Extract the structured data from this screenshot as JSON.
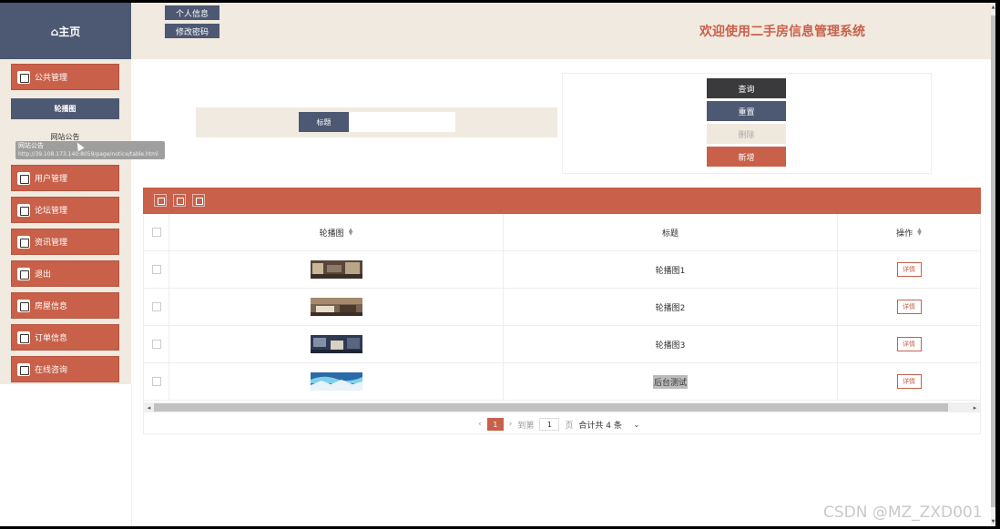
{
  "sidebar": {
    "home_label": "⌂主页",
    "menus": [
      {
        "label": "公共管理",
        "icon": "printer-icon"
      },
      {
        "label": "用户管理",
        "icon": "bar-chart-icon"
      },
      {
        "label": "论坛管理",
        "icon": "edit-icon"
      },
      {
        "label": "资讯管理",
        "icon": "bar-chart-icon"
      },
      {
        "label": "退出",
        "icon": "edit-icon"
      },
      {
        "label": "房屋信息",
        "icon": "printer-icon"
      },
      {
        "label": "订单信息",
        "icon": "bar-chart-icon"
      },
      {
        "label": "在线咨询",
        "icon": "edit-icon"
      }
    ],
    "sub_active": "轮播图",
    "sub_item": "网站公告",
    "tooltip_title": "网站公告",
    "tooltip_url": "http://39.108.173.140:8059/page/notice/table.html"
  },
  "header": {
    "profile_button": "个人信息",
    "password_button": "修改密码",
    "title": "欢迎使用二手房信息管理系统"
  },
  "search": {
    "label": "标题",
    "value": ""
  },
  "actions": {
    "query": "查询",
    "reset": "重置",
    "delete": "删除",
    "add": "新增"
  },
  "colors": {
    "accent": "#c8604a",
    "dark": "#4d5872",
    "query_bg": "#3a3a3c",
    "delete_bg": "#efe8dd",
    "panel_bg": "#f1eae0"
  },
  "table": {
    "toolbar_icons": [
      "columns-icon",
      "export-icon",
      "print-icon"
    ],
    "headers": {
      "image": "轮播图",
      "title": "标题",
      "action": "操作"
    },
    "rows": [
      {
        "title": "轮播图1",
        "action": "详情",
        "thumb": "room-photo-1"
      },
      {
        "title": "轮播图2",
        "action": "详情",
        "thumb": "room-photo-2"
      },
      {
        "title": "轮播图3",
        "action": "详情",
        "thumb": "room-photo-3"
      },
      {
        "title": "后台测试",
        "action": "详情",
        "thumb": "aurora-photo"
      }
    ]
  },
  "pager": {
    "prev": "‹",
    "current": "1",
    "next": "›",
    "goto_label": "到第",
    "goto_value": "1",
    "page_label": "页",
    "total": "合计共 4 条"
  },
  "watermark": "CSDN @MZ_ZXD001"
}
